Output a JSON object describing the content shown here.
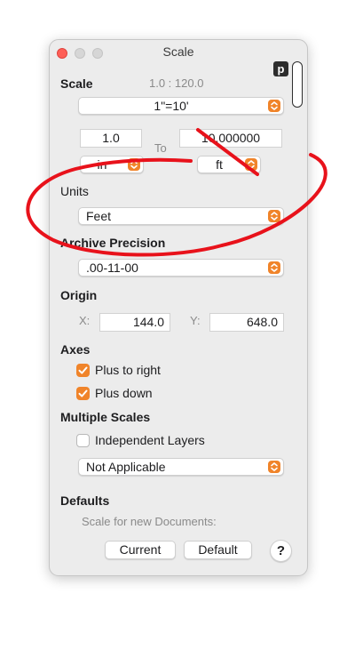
{
  "window": {
    "title": "Scale"
  },
  "scale": {
    "header": "Scale",
    "ratio": "1.0 : 120.0",
    "preset": "1\"=10'",
    "left_value": "1.0",
    "to_label": "To",
    "right_value": "10.000000",
    "left_unit": "in",
    "right_unit": "ft"
  },
  "units": {
    "header": "Units",
    "value": "Feet"
  },
  "archive_precision": {
    "header": "Archive Precision",
    "value": ".00-11-00"
  },
  "origin": {
    "header": "Origin",
    "x_label": "X:",
    "x_value": "144.0",
    "y_label": "Y:",
    "y_value": "648.0"
  },
  "axes": {
    "header": "Axes",
    "plus_right": "Plus to right",
    "plus_down": "Plus down"
  },
  "multiple_scales": {
    "header": "Multiple Scales",
    "independent_layers": "Independent Layers",
    "mode": "Not Applicable"
  },
  "defaults": {
    "header": "Defaults",
    "note": "Scale for new Documents:",
    "current_label": "Current",
    "default_label": "Default",
    "help_label": "?"
  },
  "badge": {
    "label": "p"
  },
  "colors": {
    "accent": "#f0842a",
    "annotation": "#e8121b",
    "close": "#fe5f57"
  },
  "icons": {
    "popup_arrows": "updown-chevron-icon",
    "checkbox": "checkmark-icon"
  }
}
